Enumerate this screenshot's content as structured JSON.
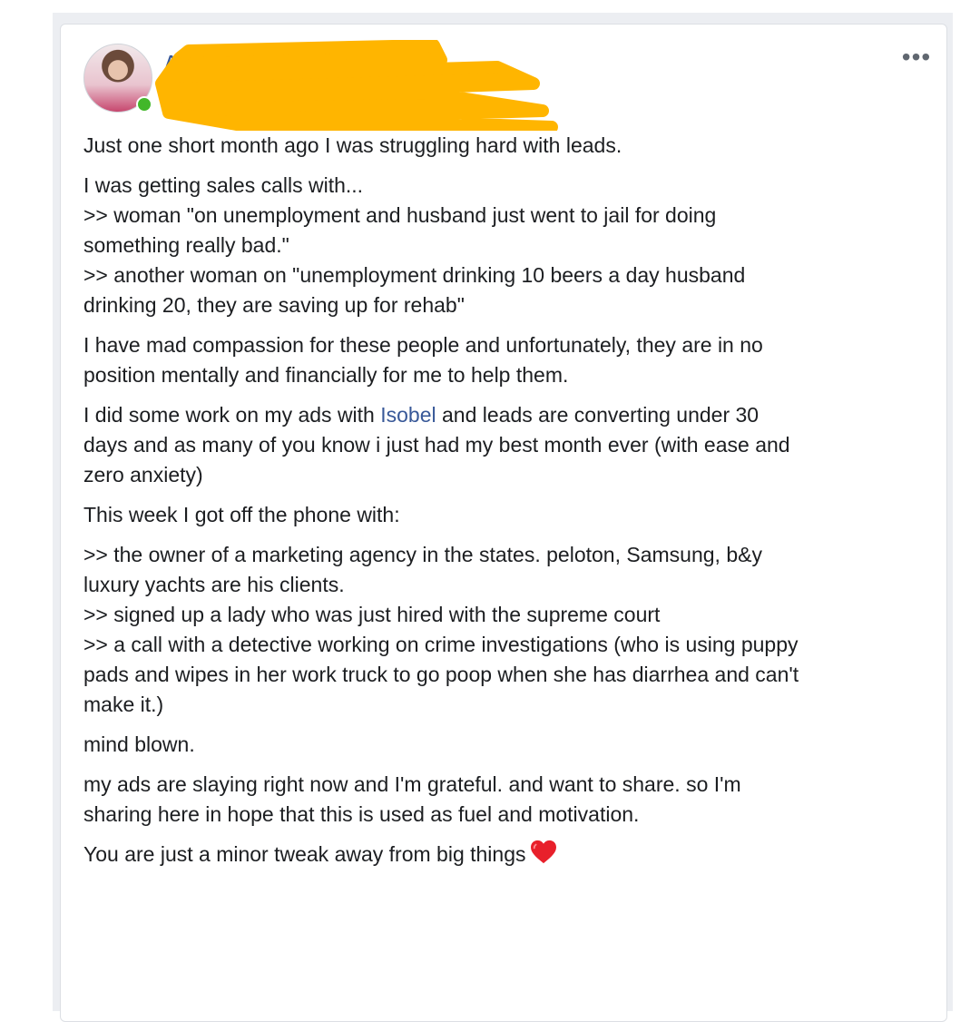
{
  "post": {
    "more_icon": "more-horizontal-icon",
    "author_visible_initial": "A",
    "redaction_color": "#ffb500",
    "online_status_color": "#42b72a",
    "mention_color": "#385898",
    "paragraphs": {
      "p1": "Just one short month ago I was struggling hard with leads.",
      "p2": {
        "l1": "I was getting sales calls with...",
        "l2": ">> woman \"on unemployment and husband just went to jail for doing",
        "l3": "something really bad.\"",
        "l4": ">> another woman on \"unemployment drinking 10 beers a day husband",
        "l5": "drinking 20, they are saving up for rehab\""
      },
      "p3": {
        "l1": "I have mad compassion for these people and unfortunately, they are in no",
        "l2": "position mentally and financially for me to help them."
      },
      "p4": {
        "l1_before": "I did some work on my ads with ",
        "mention": "Isobel",
        "l1_after": " and leads are converting under 30",
        "l2": "days and as many of you know i just had my best month ever (with ease and",
        "l3": "zero anxiety)"
      },
      "p5": "This week I got off the phone with:",
      "p6": {
        "l1": ">> the owner of a marketing agency in the states. peloton, Samsung, b&y",
        "l2": "luxury yachts are his clients.",
        "l3": ">> signed up a lady who was just hired with the supreme court",
        "l4": ">> a call with a detective working on crime investigations (who is using puppy",
        "l5": "pads and wipes in her work truck to go poop when she has diarrhea and can't",
        "l6": "make it.)"
      },
      "p7": "mind blown.",
      "p8": {
        "l1": "my ads are slaying right now and I'm grateful. and want to share. so I'm",
        "l2": "sharing here in hope that this is used as fuel and motivation."
      },
      "p9": "You are just a minor tweak away from big things",
      "p9_emoji_icon": "red-heart-icon"
    }
  }
}
